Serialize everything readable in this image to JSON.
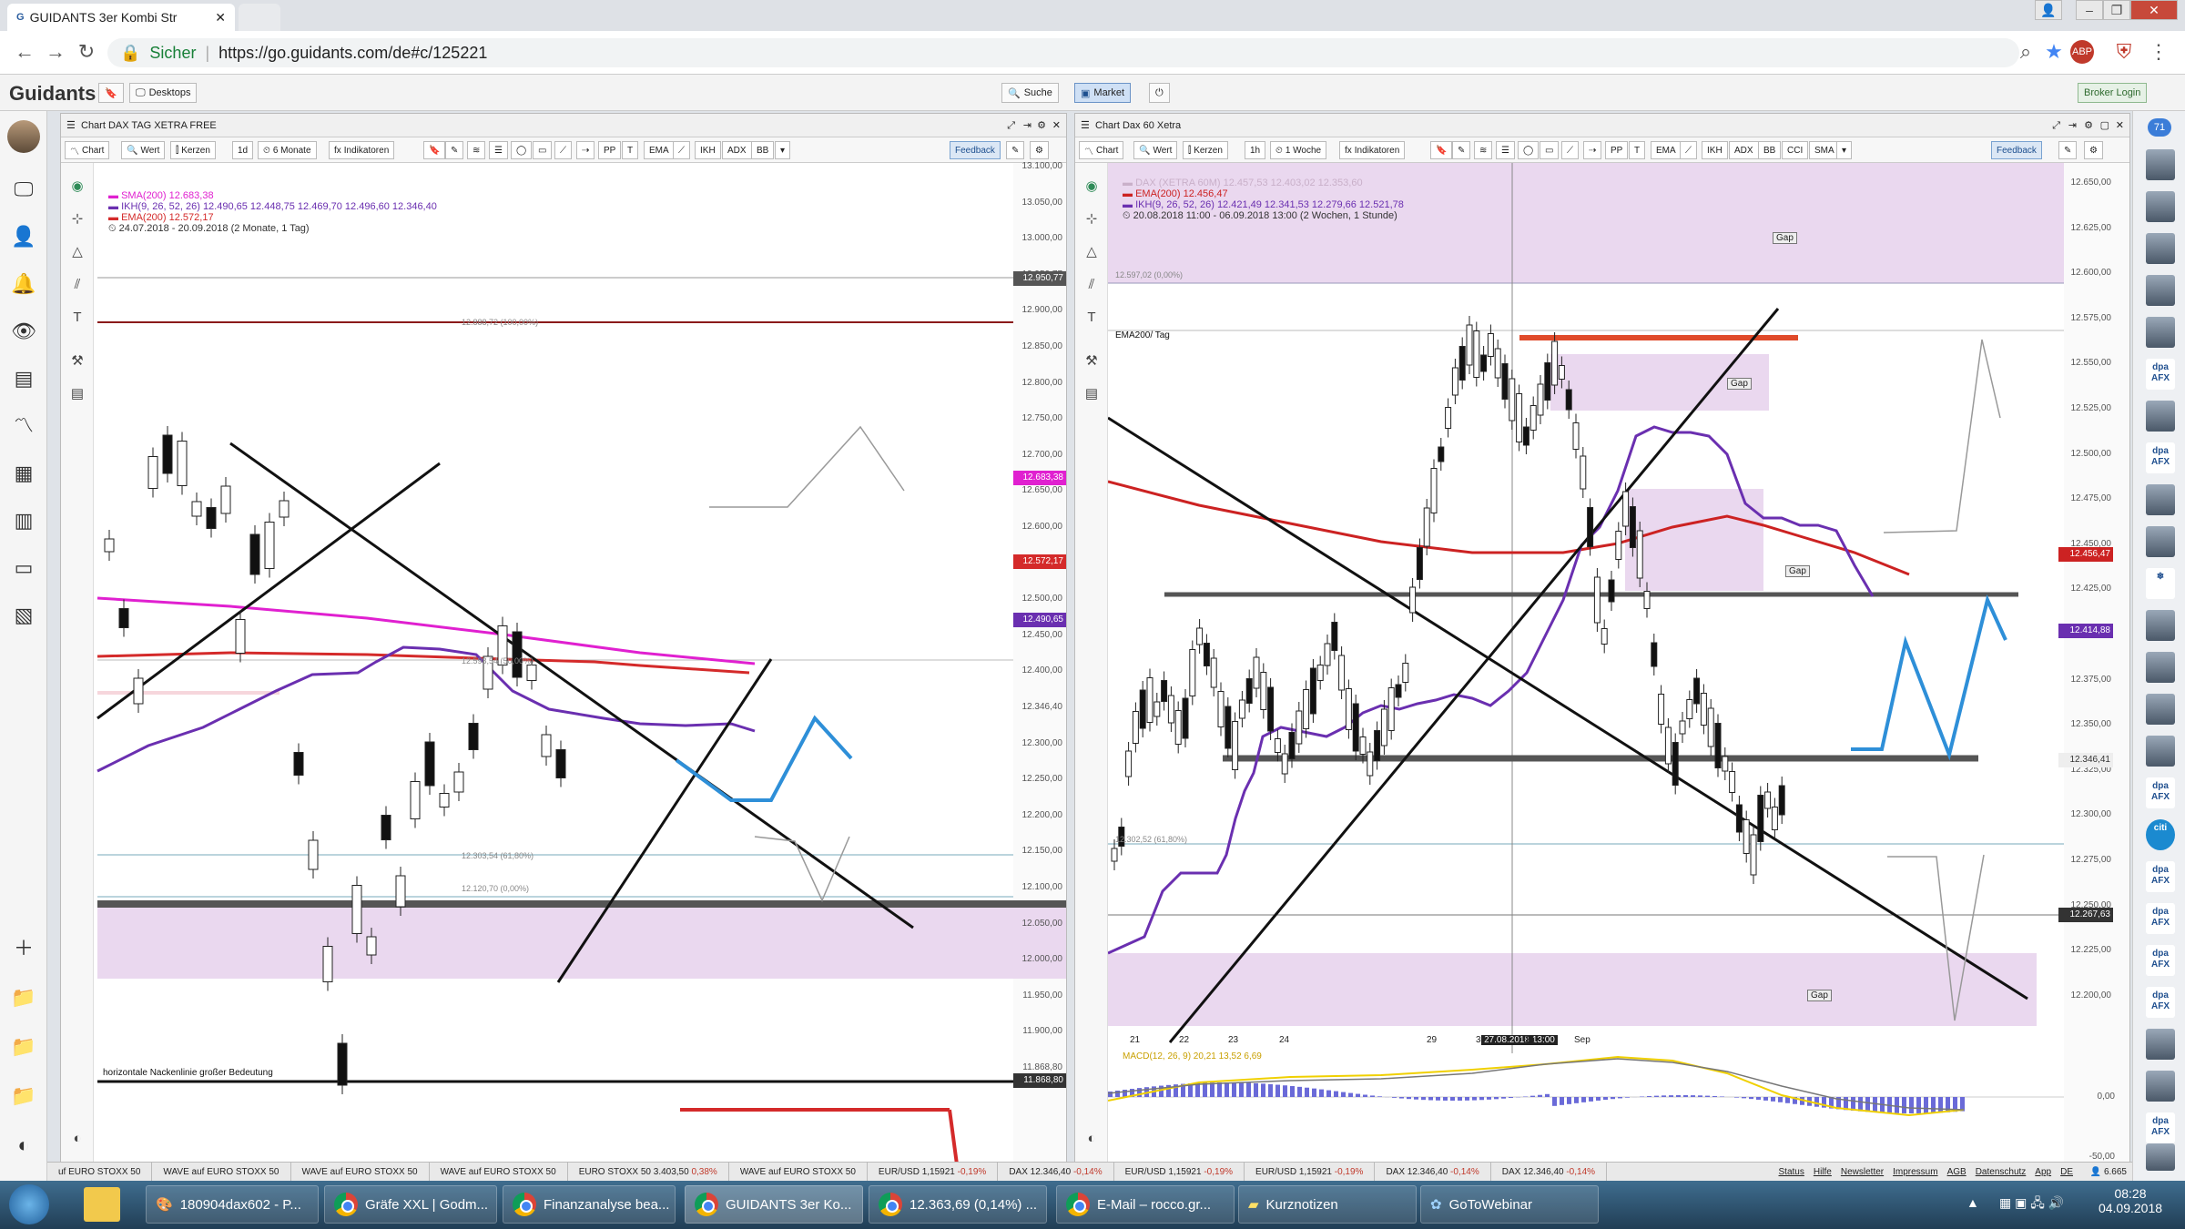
{
  "browser": {
    "tab_title": "GUIDANTS 3er Kombi Str",
    "secure_label": "Sicher",
    "url": "https://go.guidants.com/de#c/125221"
  },
  "app": {
    "logo": "Guidants",
    "desktops_label": "Desktops",
    "search_label": "Suche",
    "market_label": "Market",
    "broker_label": "Broker Login",
    "notif_count": "71"
  },
  "left_chart": {
    "title": "Chart DAX TAG XETRA FREE",
    "toolbar": {
      "chart": "Chart",
      "wert": "Wert",
      "kerzen": "Kerzen",
      "interval": "1d",
      "range": "6 Monate",
      "indikatoren": "Indikatoren",
      "pp": "PP",
      "ema": "EMA",
      "ikh": "IKH",
      "adx": "ADX",
      "bb": "BB",
      "feedback": "Feedback"
    },
    "legend": {
      "sma": "SMA(200)  12.683,38",
      "ikh": "IKH(9, 26, 52, 26)  12.490,65  12.448,75  12.469,70  12.496,60  12.346,40",
      "ema": "EMA(200)  12.572,17",
      "range": "24.07.2018 - 20.09.2018  (2 Monate, 1 Tag)"
    },
    "y_labels": [
      "13.100,00",
      "13.050,00",
      "13.000,00",
      "12.950,77",
      "12.900,00",
      "12.850,00",
      "12.800,00",
      "12.750,00",
      "12.700,00",
      "12.650,00",
      "12.600,00",
      "12.550,00",
      "12.500,00",
      "12.450,00",
      "12.400,00",
      "12.346,40",
      "12.300,00",
      "12.250,00",
      "12.200,00",
      "12.150,00",
      "12.100,00",
      "12.050,00",
      "12.000,00",
      "11.950,00",
      "11.900,00",
      "11.868,80"
    ],
    "flags": {
      "sma": "12.683,38",
      "ema": "12.572,17",
      "ikh": "12.490,65",
      "last": "12.346,40",
      "top": "12.950,77",
      "neck": "11.868,80"
    },
    "fib_labels": {
      "f100": "12.888,72 (100,00%)",
      "f50": "12.598,54 (50,00%)",
      "f618": "12.303,54 (61,80%)",
      "f0": "12.120,70 (0,00%)"
    },
    "neckline_text": "horizontale Nackenlinie großer Bedeutung"
  },
  "right_chart": {
    "title": "Chart Dax 60 Xetra",
    "toolbar": {
      "chart": "Chart",
      "wert": "Wert",
      "kerzen": "Kerzen",
      "interval": "1h",
      "range": "1 Woche",
      "indikatoren": "Indikatoren",
      "pp": "PP",
      "ema": "EMA",
      "ikh": "IKH",
      "adx": "ADX",
      "bb": "BB",
      "cci": "CCI",
      "sma": "SMA",
      "feedback": "Feedback"
    },
    "legend": {
      "dax": "DAX (XETRA 60M)  12.457,53  12.403,02  12.353,60",
      "ema": "EMA(200)  12.456,47",
      "ikh": "IKH(9, 26, 52, 26)  12.421,49  12.341,53  12.279,66  12.521,78",
      "range": "20.08.2018 11:00 - 06.09.2018 13:00  (2 Wochen, 1 Stunde)"
    },
    "ema_tag": "EMA200/ Tag",
    "gap_labels": [
      "Gap",
      "Gap",
      "Gap",
      "Gap"
    ],
    "y_labels": [
      "12.650,00",
      "12.625,00",
      "12.600,00",
      "12.575,00",
      "12.550,00",
      "12.525,00",
      "12.500,00",
      "12.475,00",
      "12.450,00",
      "12.425,00",
      "12.400,00",
      "12.375,00",
      "12.350,00",
      "12.325,00",
      "12.300,00",
      "12.275,00",
      "12.250,00",
      "12.225,00",
      "12.200,00"
    ],
    "flags": {
      "ema": "12.456,47",
      "last": "12.414,88",
      "price2": "12.346,41",
      "cross": "12.267,63"
    },
    "fib_labels": {
      "f0": "12.597,02 (0,00%)",
      "f618": "12.302,52 (61,80%)"
    },
    "x_labels": [
      "21",
      "22",
      "23",
      "24",
      "27.08.2018 13:00",
      "29",
      "30",
      "31",
      "Sep"
    ],
    "macd_legend": "MACD(12, 26, 9)  20,21  13,52  6,69",
    "macd_y": [
      "0,00",
      "-50,00"
    ]
  },
  "ticker": [
    {
      "name": "uf EURO STOXX 50",
      "chg": ""
    },
    {
      "name": "WAVE auf EURO STOXX 50",
      "chg": ""
    },
    {
      "name": "WAVE auf EURO STOXX 50",
      "chg": ""
    },
    {
      "name": "WAVE auf EURO STOXX 50",
      "chg": ""
    },
    {
      "name": "EURO STOXX 50 3.403,50",
      "chg": "0,38%"
    },
    {
      "name": "WAVE auf EURO STOXX 50",
      "chg": ""
    },
    {
      "name": "EUR/USD 1,15921",
      "chg": "-0,19%"
    },
    {
      "name": "DAX 12.346,40",
      "chg": "-0,14%"
    },
    {
      "name": "EUR/USD 1,15921",
      "chg": "-0,19%"
    },
    {
      "name": "EUR/USD 1,15921",
      "chg": "-0,19%"
    },
    {
      "name": "DAX 12.346,40",
      "chg": "-0,14%"
    },
    {
      "name": "DAX 12.346,40",
      "chg": "-0,14%"
    }
  ],
  "footer_links": [
    "Status",
    "Hilfe",
    "Newsletter",
    "Impressum",
    "AGB",
    "Datenschutz",
    "App",
    "DE"
  ],
  "footer_count": "6.665",
  "taskbar": {
    "items": [
      "180904dax602 - P...",
      "Gräfe XXL | Godm...",
      "Finanzanalyse bea...",
      "GUIDANTS 3er Ko...",
      "12.363,69 (0,14%) ...",
      "E-Mail – rocco.gr...",
      "Kurznotizen",
      "GoToWebinar"
    ],
    "time": "08:28",
    "date": "04.09.2018"
  }
}
